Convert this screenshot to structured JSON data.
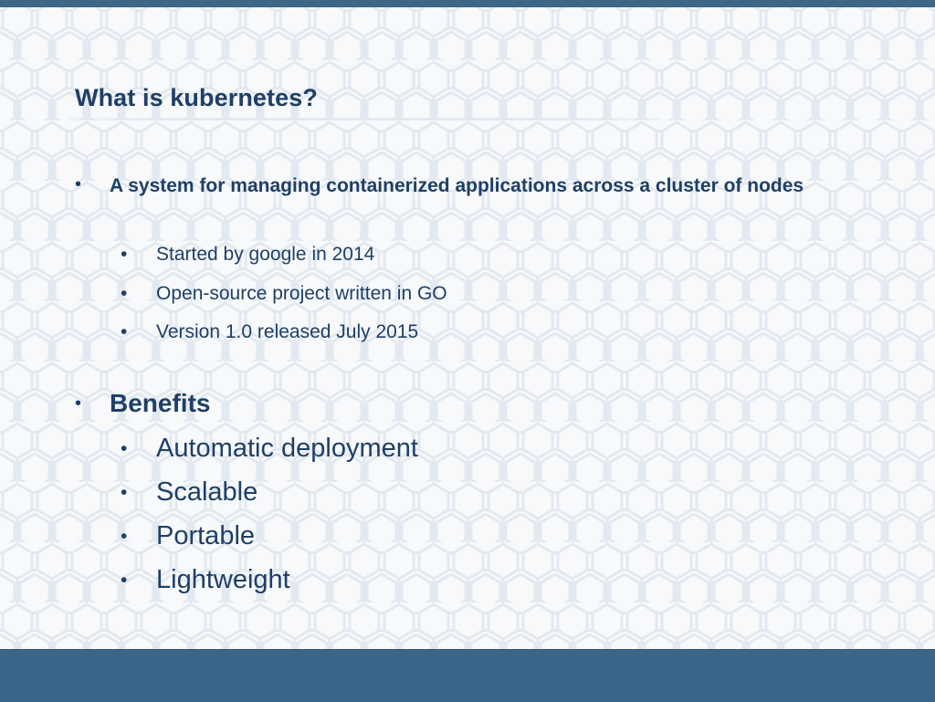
{
  "slide": {
    "title": "What is kubernetes?",
    "items": [
      {
        "text": "A system for managing containerized applications across a cluster of nodes",
        "subitems": [
          "Started by google in 2014",
          "Open-source project written in GO",
          "Version 1.0 released July 2015"
        ]
      },
      {
        "text": "Benefits",
        "subitems": [
          "Automatic deployment",
          "Scalable",
          "Portable",
          "Lightweight"
        ]
      }
    ],
    "bullet_symbol": "•"
  },
  "colors": {
    "header_bar": "#3d6688",
    "footer_bar": "#3a6689",
    "text": "#1f3f66",
    "background": "#f7f9fb",
    "hex_pattern": "#e3e9f0"
  }
}
